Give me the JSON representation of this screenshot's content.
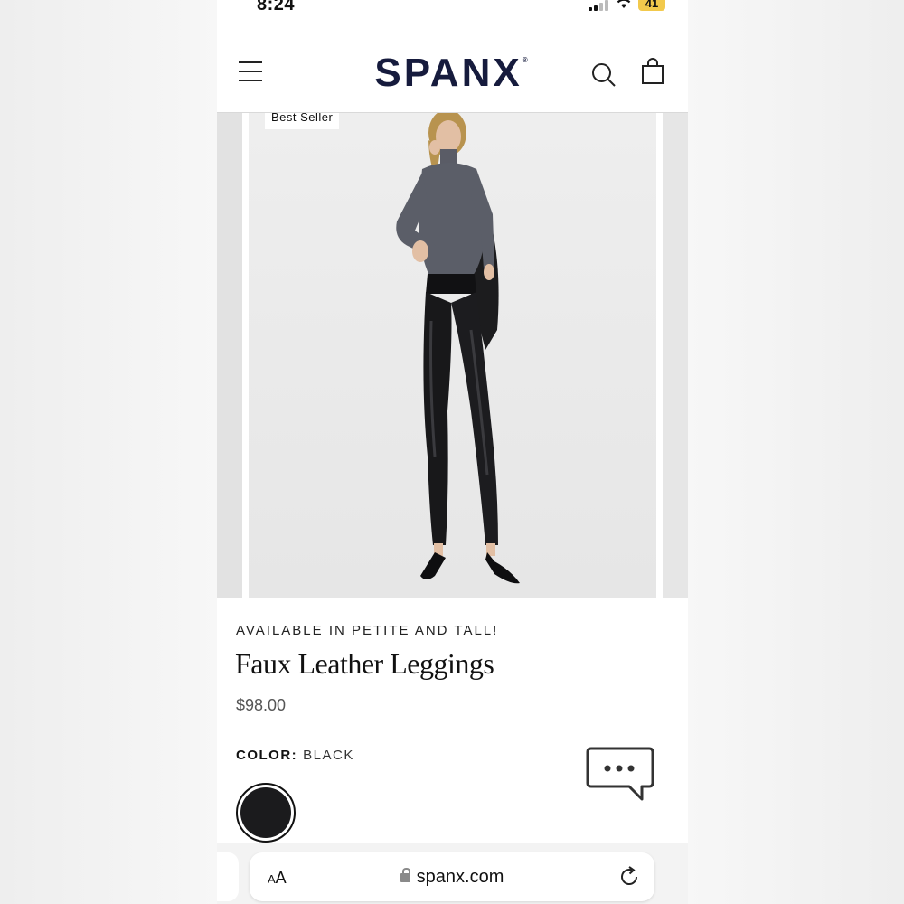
{
  "status_bar": {
    "time": "8:24",
    "battery": "41"
  },
  "header": {
    "logo": "SPANX",
    "logo_mark": "®"
  },
  "carousel": {
    "badge": "Best Seller"
  },
  "product": {
    "availability": "AVAILABLE IN PETITE AND TALL!",
    "title": "Faux Leather Leggings",
    "price": "$98.00",
    "color_label": "COLOR:",
    "color_value": "BLACK",
    "swatch_color": "#1b1b1d"
  },
  "browser": {
    "text_size_label_small": "A",
    "text_size_label_large": "A",
    "url": "spanx.com"
  },
  "icons": [
    "menu-icon",
    "search-icon",
    "shopping-bag-icon",
    "chat-icon",
    "lock-icon",
    "reload-icon"
  ]
}
